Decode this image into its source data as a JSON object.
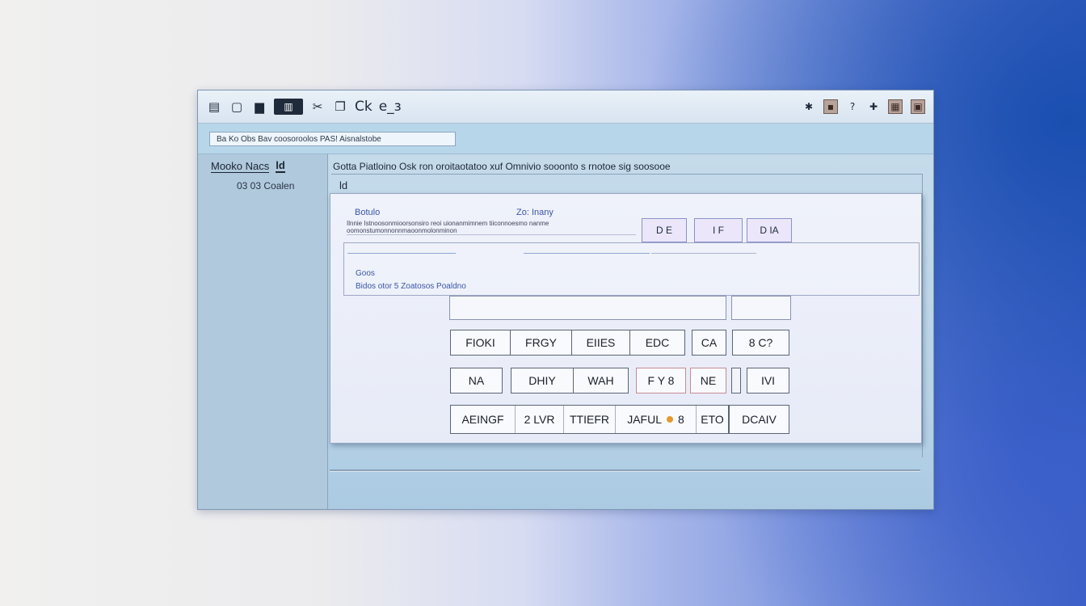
{
  "toolbar": {
    "icons": [
      {
        "name": "save-icon",
        "glyph": "▤"
      },
      {
        "name": "document-icon",
        "glyph": "▢"
      },
      {
        "name": "panel-icon",
        "glyph": "▆"
      },
      {
        "name": "view-icon",
        "glyph": "▥"
      },
      {
        "name": "cut-icon",
        "glyph": "✂"
      },
      {
        "name": "copy-icon",
        "glyph": "❐"
      }
    ],
    "text_items": [
      "Ck",
      "e_з"
    ],
    "right_icons": [
      "star-icon",
      "box-icon",
      "help-icon",
      "pin-icon",
      "grid-icon",
      "close-icon"
    ]
  },
  "address": {
    "value": "Ba Ko Obs Bav coosoroolos PAS! Aisnalstobe"
  },
  "sidebar": {
    "header": "Mooko Nacs",
    "header_badge": "ld",
    "subitem": "03 03 Coalen"
  },
  "main": {
    "breadcrumb": "Gotta Piatloino Osk ron oroitaotatoo xuf Omnivio sooonto s rnotoe sig soosooe",
    "subpanel_label": "ld"
  },
  "dialog": {
    "label_left": "Botulo",
    "label_right": "Zo: Inany",
    "description": "Ilnnie Istnoosonmioorsonsiro reoi uionanmimnem tiiconnoesmo nanme oomonstumonnonnmaoonmolonminon",
    "buttons": [
      "D E",
      "I F",
      "D IA"
    ],
    "section_caption": "Goos",
    "section_subcaption": "Bidos otor 5 Zoatosos Poaldno"
  },
  "keyboard": {
    "row1": [
      "FIOKI",
      "FRGY",
      "EIIES",
      "EDC",
      "CA",
      "8 C?"
    ],
    "row2": [
      "NA",
      "DHIY",
      "WAH",
      "F Y 8",
      "NE",
      "",
      "IVI"
    ],
    "row3": [
      "AEINGF",
      "2 LVR",
      "TTIEFR",
      "JAFUL",
      "8",
      "ETO",
      "DCAIV"
    ]
  },
  "colors": {
    "accent": "#3a55a8",
    "orange_dot": "#e59a2c",
    "window_bg": "#aecbe4"
  }
}
